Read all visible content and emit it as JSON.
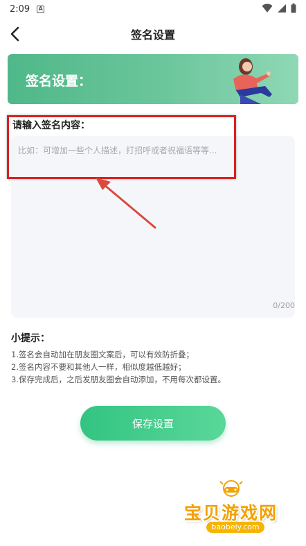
{
  "status_bar": {
    "time": "2:09",
    "app_icon_letter": "A"
  },
  "header": {
    "title": "签名设置",
    "back_icon": "back-arrow-icon"
  },
  "banner": {
    "title": "签名设置："
  },
  "signature_input": {
    "label": "请输入签名内容：",
    "placeholder": "比如：可增加一些个人描述，打招呼或者祝福语等等...",
    "value": "",
    "char_count": "0/200"
  },
  "tips": {
    "title": "小提示：",
    "items": [
      "1.签名会自动加在朋友圈文案后，可以有效防折叠；",
      "2.签名内容不要和其他人一样，相似度越低越好；",
      "3.保存完成后，之后发朋友圈会自动添加，不用每次都设置。"
    ]
  },
  "save_button": {
    "label": "保存设置"
  },
  "watermark": {
    "text": "宝贝游戏网",
    "domain": "baobeiy.com"
  },
  "colors": {
    "accent_green": "#33c482",
    "banner_green": "#4fb889",
    "highlight_red": "#dd1f1f",
    "watermark_orange": "#f2a100"
  }
}
